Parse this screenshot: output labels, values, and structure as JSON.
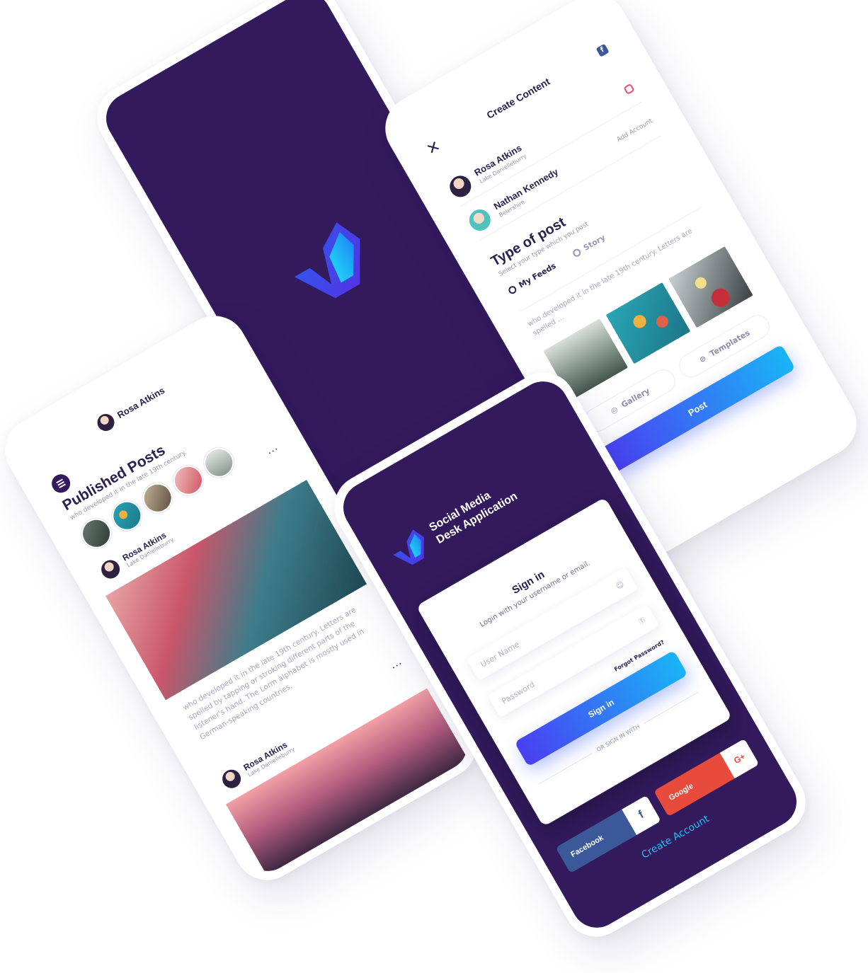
{
  "splash": {
    "pager_dots": 3,
    "active_dot": 1
  },
  "create_content": {
    "title": "Create Content",
    "close_icon": "close-icon",
    "accounts": [
      {
        "name": "Rosa Atkins",
        "location": "Lake Danielleburry",
        "network": "instagram"
      },
      {
        "name": "Nathan Kennedy",
        "location": "Belershire",
        "badge": "Add Account"
      }
    ],
    "type_title": "Type of post",
    "type_sub": "Select your type which you post",
    "options": [
      {
        "label": "My Feeds",
        "selected": true
      },
      {
        "label": "Story",
        "selected": false
      }
    ],
    "text": "who developed it in the late 19th century. Letters are spelled ...",
    "gallery_label": "Gallery",
    "templates_label": "Templates",
    "post_label": "Post"
  },
  "published": {
    "user_name": "Rosa Atkins",
    "title": "Published Posts",
    "subtitle": "who developed it in the late 19th century.",
    "posts": [
      {
        "name": "Rosa Atkins",
        "location": "Lake Danielleburry",
        "text": "who developed it in the late 19th century. Letters are spelled by tapping or stroking different parts of the listener's hand. The Lorm alphabet is mostly used in German-speaking countries."
      },
      {
        "name": "Rosa Atkins",
        "location": "Lake Danielleburry"
      }
    ],
    "more_label": "..."
  },
  "signin": {
    "brand_line1": "Social Media",
    "brand_line2": "Desk Application",
    "title": "Sign in",
    "subtitle": "Login with your username or email.",
    "username_placeholder": "User Name",
    "password_placeholder": "Password",
    "forgot": "Forgot Password?",
    "button": "Sign in",
    "or_text": "OR SIGN IN WITH",
    "facebook": "Facebook",
    "facebook_icon": "f",
    "google": "Google",
    "google_icon": "G+",
    "create_account": "Create Account"
  },
  "colors": {
    "brand_dark": "#321a5c",
    "accent_blue": "#1ab4f6",
    "accent_violet": "#4a3ff2",
    "facebook": "#3b5998",
    "google": "#e84a3c"
  }
}
